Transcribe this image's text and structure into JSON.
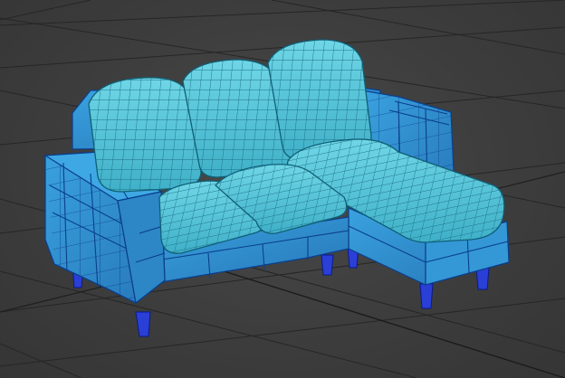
{
  "viewport": {
    "view_name": "Perspective",
    "background_color": "#3c3c3c",
    "grid_color": "#262626"
  },
  "model": {
    "object_name": "sectional-sofa",
    "display_mode": "wireframe-on-shaded",
    "colors": {
      "cushion_fill": "#4fc3d6",
      "cushion_wire": "#1b6f86",
      "frame_fill": "#2f8fd0",
      "frame_wire": "#0a3f8e",
      "leg_fill": "#2a3fd6"
    }
  }
}
